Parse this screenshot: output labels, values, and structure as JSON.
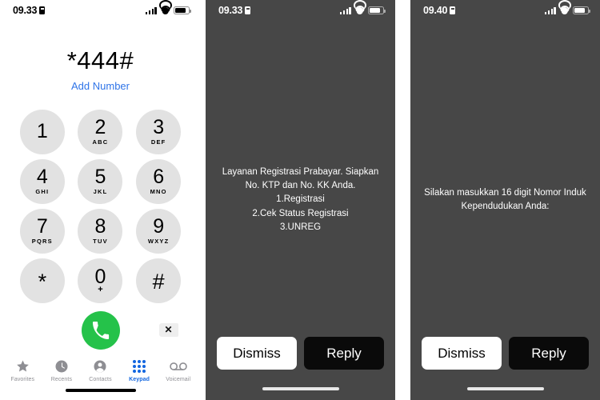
{
  "dialer": {
    "statusbar": {
      "time": "09.33",
      "lock_icon": "lock-icon",
      "signal_icon": "cellular-signal-icon",
      "wifi_icon": "wifi-icon",
      "battery_icon": "battery-icon"
    },
    "dialed_number": "*444#",
    "add_number_label": "Add Number",
    "keys": [
      {
        "digit": "1",
        "letters": ""
      },
      {
        "digit": "2",
        "letters": "ABC"
      },
      {
        "digit": "3",
        "letters": "DEF"
      },
      {
        "digit": "4",
        "letters": "GHI"
      },
      {
        "digit": "5",
        "letters": "JKL"
      },
      {
        "digit": "6",
        "letters": "MNO"
      },
      {
        "digit": "7",
        "letters": "PQRS"
      },
      {
        "digit": "8",
        "letters": "TUV"
      },
      {
        "digit": "9",
        "letters": "WXYZ"
      },
      {
        "digit": "*",
        "letters": ""
      },
      {
        "digit": "0",
        "letters": "+"
      },
      {
        "digit": "#",
        "letters": ""
      }
    ],
    "call_button": {
      "icon": "phone-icon",
      "color": "#25c24a"
    },
    "delete_button": {
      "icon": "backspace-delete-icon",
      "glyph": "✕"
    },
    "tabs": [
      {
        "label": "Favorites",
        "icon": "star-icon",
        "active": false
      },
      {
        "label": "Recents",
        "icon": "clock-icon",
        "active": false
      },
      {
        "label": "Contacts",
        "icon": "person-circle-icon",
        "active": false
      },
      {
        "label": "Keypad",
        "icon": "keypad-dots-icon",
        "active": true
      },
      {
        "label": "Voicemail",
        "icon": "voicemail-icon",
        "active": false
      }
    ],
    "accent_color": "#1266e0",
    "inactive_color": "#8e8e93"
  },
  "ussd_1": {
    "statusbar": {
      "time": "09.33",
      "lock_icon": "lock-icon",
      "signal_icon": "cellular-signal-icon",
      "wifi_icon": "wifi-icon",
      "battery_icon": "battery-icon"
    },
    "message": "Layanan Registrasi Prabayar. Siapkan No. KTP dan No. KK Anda.\n1.Registrasi\n2.Cek Status Registrasi\n3.UNREG",
    "dismiss_label": "Dismiss",
    "reply_label": "Reply",
    "background_color": "#474747"
  },
  "ussd_2": {
    "statusbar": {
      "time": "09.40",
      "lock_icon": "lock-icon",
      "signal_icon": "cellular-signal-icon",
      "wifi_icon": "wifi-icon",
      "battery_icon": "battery-icon"
    },
    "message": "Silakan masukkan 16 digit Nomor Induk Kependudukan Anda:",
    "dismiss_label": "Dismiss",
    "reply_label": "Reply",
    "background_color": "#474747"
  }
}
